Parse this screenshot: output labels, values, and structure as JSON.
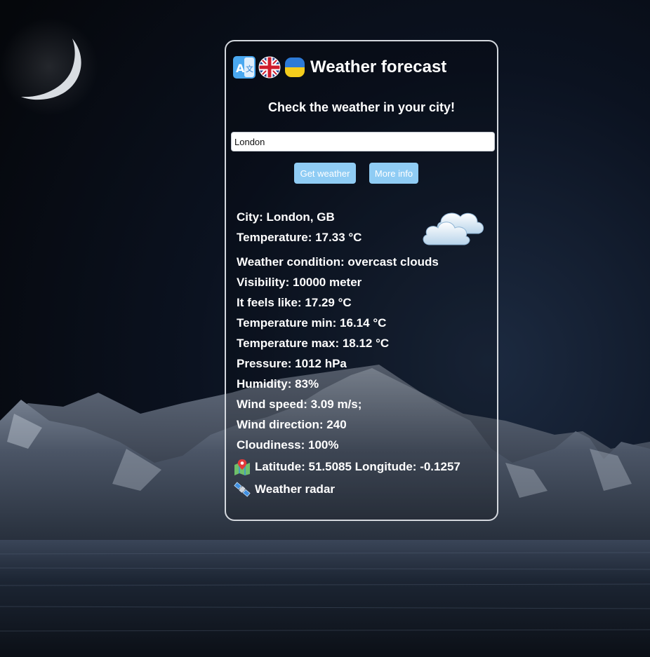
{
  "colors": {
    "accent_button": "#8fccf4",
    "card_border": "#d4d8de",
    "text": "#ffffff"
  },
  "header": {
    "icons": [
      "translate-icon",
      "uk-flag-icon",
      "ukraine-flag-icon"
    ],
    "title": "Weather forecast"
  },
  "subtitle": "Check the weather in your city!",
  "search": {
    "value": "London",
    "placeholder": ""
  },
  "buttons": {
    "get_weather": "Get weather",
    "more_info": "More info"
  },
  "weather": {
    "icon": "cloud-icon",
    "city": "City: London, GB",
    "temperature": "Temperature: 17.33 °C",
    "condition": "Weather condition: overcast clouds",
    "visibility": "Visibility: 10000 meter",
    "feels_like": "It feels like: 17.29 °C",
    "temp_min": "Temperature min: 16.14 °C",
    "temp_max": "Temperature max: 18.12 °C",
    "pressure": "Pressure: 1012 hPa",
    "humidity": "Humidity: 83%",
    "wind_speed": "Wind speed: 3.09 m/s;",
    "wind_direction": "Wind direction: 240",
    "cloudiness": "Cloudiness: 100%",
    "coordinates": "Latitude: 51.5085 Longitude: -0.1257",
    "radar": "Weather radar"
  }
}
